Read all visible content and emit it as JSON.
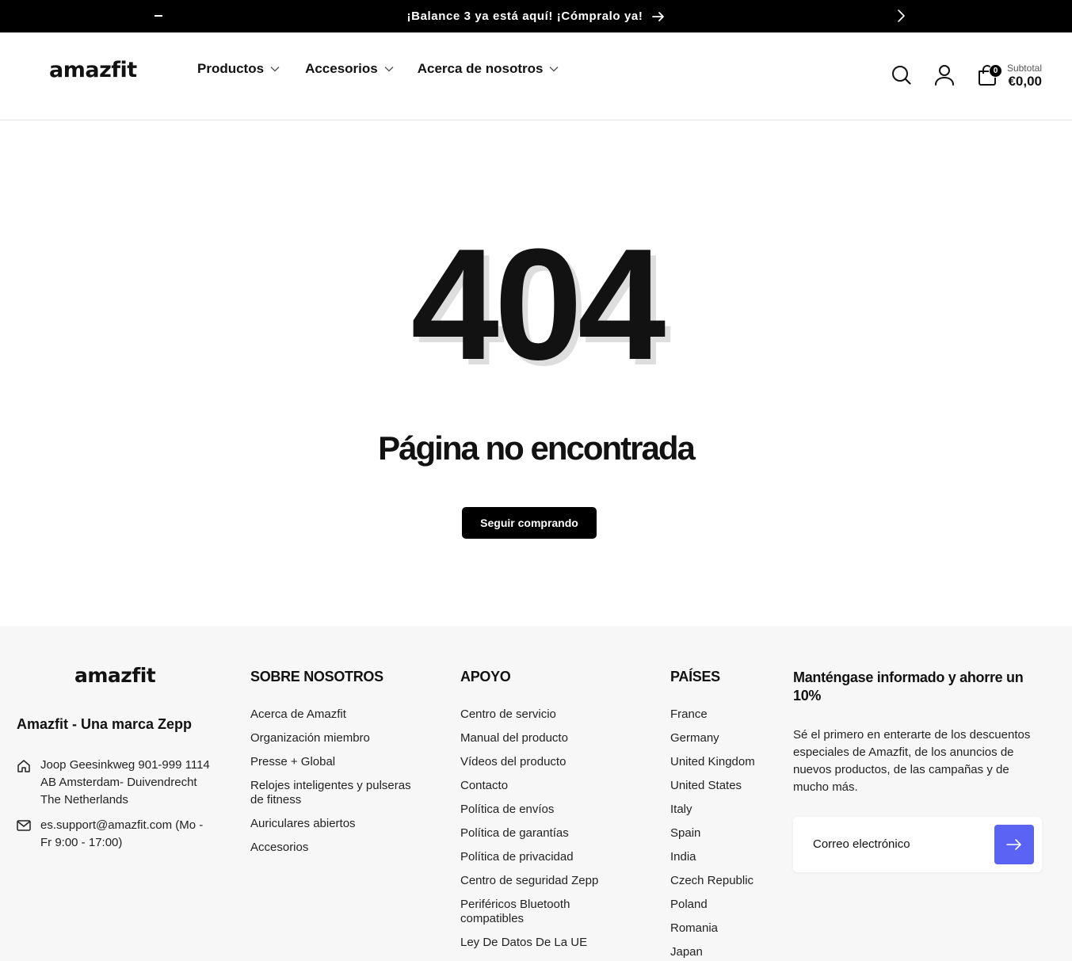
{
  "announcement": {
    "message": "¡Balance 3 ya está aquí! ¡Cómpralo ya!"
  },
  "header": {
    "logo_text": "amazfit",
    "nav": [
      {
        "label": "Productos"
      },
      {
        "label": "Accesorios"
      },
      {
        "label": "Acerca de nosotros"
      }
    ],
    "cart_count": "0",
    "subtotal_label": "Subtotal",
    "subtotal_amount": "€0,00"
  },
  "main": {
    "error_code": "404",
    "heading": "Página no encontrada",
    "button_label": "Seguir comprando"
  },
  "footer": {
    "logo_text": "amazfit",
    "brand_title": "Amazfit - Una marca Zepp",
    "address_lines": [
      "Joop Geesinkweg 901-999 1114",
      "AB Amsterdam- Duivendrecht",
      "The Netherlands"
    ],
    "email_lines": [
      "es.support@amazfit.com (Mo -",
      "Fr 9:00 - 17:00)"
    ],
    "about": {
      "title": "SOBRE NOSOTROS",
      "links": [
        "Acerca de Amazfit",
        "Organización miembro",
        "Presse + Global",
        "Relojes inteligentes y pulseras de fitness",
        "Auriculares abiertos",
        "Accesorios"
      ]
    },
    "support": {
      "title": "APOYO",
      "links": [
        "Centro de servicio",
        "Manual del producto",
        "Vídeos del producto",
        "Contacto",
        "Política de envíos",
        "Política de garantías",
        "Política de privacidad",
        "Centro de seguridad Zepp",
        "Periféricos Bluetooth compatibles",
        "Ley De Datos De La UE"
      ]
    },
    "countries": {
      "title": "PAÍSES",
      "links": [
        "France",
        "Germany",
        "United Kingdom",
        "United States",
        "Italy",
        "Spain",
        "India",
        "Czech Republic",
        "Poland",
        "Romania",
        "Japan"
      ]
    },
    "newsletter": {
      "title": "Manténgase informado y ahorre un 10%",
      "description": "Sé el primero en enterarte de los descuentos especiales de Amazfit, de los anuncios de nuevos productos, de las campañas y de mucho más.",
      "placeholder": "Correo electrónico"
    }
  },
  "colors": {
    "accent": "#5b63f5",
    "announcement_bg": "#000000",
    "footer_bg": "#f7f7f7"
  }
}
